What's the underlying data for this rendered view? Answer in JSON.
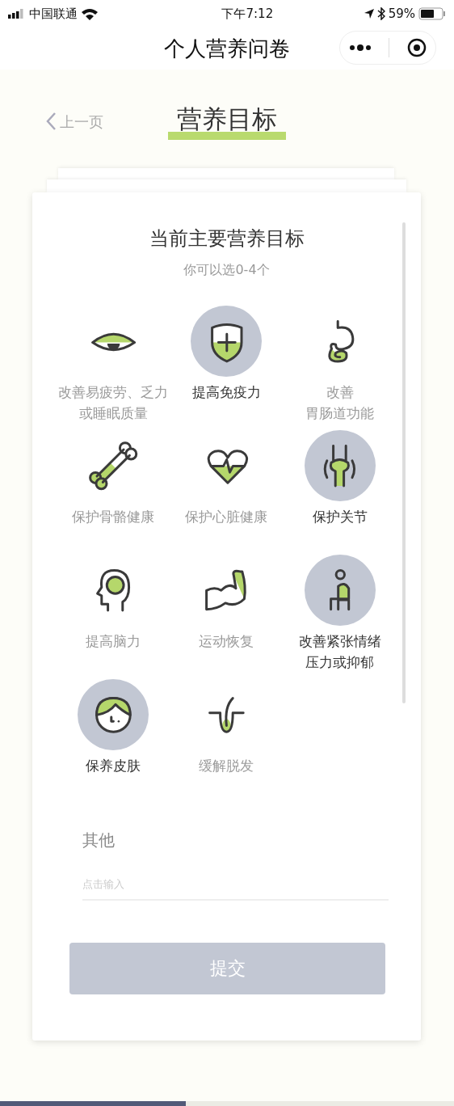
{
  "status_bar": {
    "carrier": "中国联通",
    "time": "下午7:12",
    "battery": "59%"
  },
  "nav_bar": {
    "title": "个人营养问卷"
  },
  "header": {
    "back": "上一页",
    "title": "营养目标"
  },
  "question": {
    "title": "当前主要营养目标",
    "hint": "你可以选0-4个"
  },
  "options": [
    {
      "kind": "eye",
      "lines": [
        "改善易疲劳、乏力",
        "或睡眠质量"
      ],
      "selected": false
    },
    {
      "kind": "shield",
      "lines": [
        "提高免疫力"
      ],
      "selected": true
    },
    {
      "kind": "stomach",
      "lines": [
        "改善",
        "胃肠道功能"
      ],
      "selected": false
    },
    {
      "kind": "bone",
      "lines": [
        "保护骨骼健康"
      ],
      "selected": false
    },
    {
      "kind": "heart",
      "lines": [
        "保护心脏健康"
      ],
      "selected": false
    },
    {
      "kind": "joint",
      "lines": [
        "保护关节"
      ],
      "selected": true
    },
    {
      "kind": "head",
      "lines": [
        "提高脑力"
      ],
      "selected": false
    },
    {
      "kind": "arm",
      "lines": [
        "运动恢复"
      ],
      "selected": false
    },
    {
      "kind": "person",
      "lines": [
        "改善紧张情绪",
        "压力或抑郁"
      ],
      "selected": true
    },
    {
      "kind": "face",
      "lines": [
        "保养皮肤"
      ],
      "selected": true
    },
    {
      "kind": "hair",
      "lines": [
        "缓解脱发"
      ],
      "selected": false
    }
  ],
  "other": {
    "label": "其他",
    "placeholder": "点击输入"
  },
  "submit": {
    "label": "提交",
    "disabled": true
  },
  "progress": {
    "level": 0.41
  }
}
